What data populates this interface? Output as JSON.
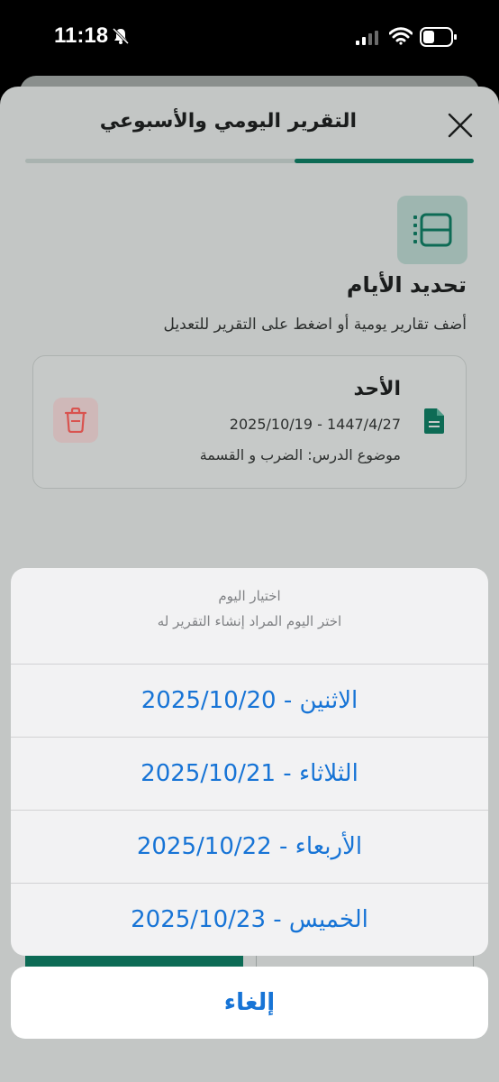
{
  "status": {
    "time": "11:18"
  },
  "sheet": {
    "title": "التقرير اليومي والأسبوعي",
    "progress": 0.4
  },
  "section": {
    "title": "تحديد الأيام",
    "subtitle": "أضف تقارير يومية أو اضغط على التقرير للتعديل"
  },
  "report": {
    "day": "الأحد",
    "date": "2025/10/19 - 1447/4/27",
    "topic": "موضوع الدرس: الضرب و القسمة"
  },
  "action_sheet": {
    "title": "اختيار اليوم",
    "message": "اختر اليوم المراد إنشاء التقرير له",
    "options": [
      "الاثنين - 2025/10/20",
      "الثلاثاء - 2025/10/21",
      "الأربعاء - 2025/10/22",
      "الخميس - 2025/10/23"
    ],
    "cancel": "إلغاء"
  },
  "colors": {
    "accent": "#0d6b55",
    "link": "#1774d6",
    "danger": "#d9534f"
  }
}
